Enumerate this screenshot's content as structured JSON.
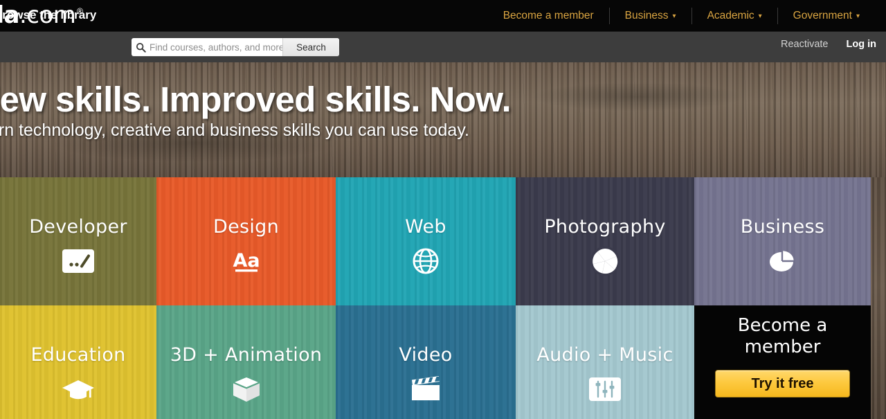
{
  "brand": {
    "logo_text": "nda",
    "logo_suffix": ".com",
    "logo_registered": "®"
  },
  "topnav": {
    "items": [
      {
        "label": "Become a member",
        "has_caret": false,
        "icon": ""
      },
      {
        "label": "Business",
        "has_caret": true,
        "icon": "chevron-down-icon"
      },
      {
        "label": "Academic",
        "has_caret": true,
        "icon": "chevron-down-icon"
      },
      {
        "label": "Government",
        "has_caret": true,
        "icon": "chevron-down-icon"
      }
    ],
    "caret_glyph": "⌄"
  },
  "subbar": {
    "browse_label": "Browse the library",
    "search": {
      "placeholder": "Find courses, authors, and more...",
      "value": "",
      "button_label": "Search",
      "icon": "search-icon"
    },
    "reactivate_label": "Reactivate",
    "login_label": "Log in"
  },
  "hero": {
    "headline": "lew skills. Improved skills. Now.",
    "subhead": "arn technology, creative and business skills you can use today."
  },
  "tiles": [
    {
      "label": "Developer",
      "icon": "code-prompt-icon",
      "color": "#77743a",
      "text_color": "#ffffff"
    },
    {
      "label": "Design",
      "icon": "typography-icon",
      "color": "#e85a29",
      "text_color": "#ffffff"
    },
    {
      "label": "Web",
      "icon": "globe-icon",
      "color": "#21a5b4",
      "text_color": "#ffffff"
    },
    {
      "label": "Photography",
      "icon": "aperture-icon",
      "color": "#3b3b4c",
      "text_color": "#ffffff"
    },
    {
      "label": "Business",
      "icon": "pie-chart-icon",
      "color": "#757490",
      "text_color": "#ffffff"
    },
    {
      "label": "Education",
      "icon": "graduation-cap-icon",
      "color": "#dfc22f",
      "text_color": "#ffffff"
    },
    {
      "label": "3D + Animation",
      "icon": "cube-box-icon",
      "color": "#5aa588",
      "text_color": "#ffffff"
    },
    {
      "label": "Video",
      "icon": "clapperboard-icon",
      "color": "#2a6f91",
      "text_color": "#ffffff"
    },
    {
      "label": "Audio + Music",
      "icon": "equalizer-icon",
      "color": "#a4c8cf",
      "text_color": "#ffffff"
    }
  ],
  "member_tile": {
    "title_line1": "Become a",
    "title_line2": "member",
    "cta_label": "Try it free",
    "background": "#050505",
    "cta_color": "#fdc93f"
  }
}
